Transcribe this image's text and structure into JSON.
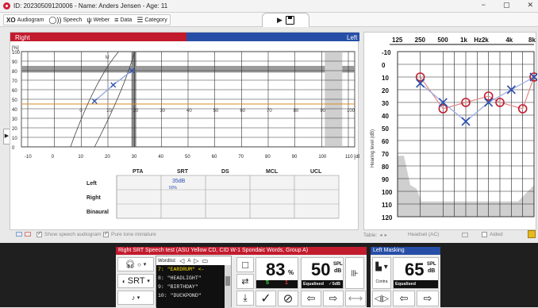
{
  "window": {
    "title": "ID: 20230509120006  -  Name: Anders Jensen - Age: 11",
    "controls": [
      "−",
      "▢",
      "✕"
    ]
  },
  "toolbar": {
    "tools": [
      {
        "icon": "XO",
        "label": "Audiogram"
      },
      {
        "icon": "speech-icon",
        "label": "Speech"
      },
      {
        "icon": "weber-icon",
        "label": "Weber"
      },
      {
        "icon": "data-icon",
        "label": "Data"
      },
      {
        "icon": "category-icon",
        "label": "Category"
      }
    ],
    "play_symbol": "▶"
  },
  "speech_audiogram": {
    "header_left": "Right",
    "header_right": "Left",
    "y_unit": "[%]",
    "y_ticks": [
      "100",
      "90",
      "80",
      "70",
      "60",
      "50",
      "40",
      "30",
      "20",
      "10",
      "0"
    ],
    "x_ticks": [
      "-10",
      "0",
      "10",
      "20",
      "30",
      "40",
      "50",
      "60",
      "70",
      "80",
      "90",
      "100",
      "110 [dB SPL]"
    ],
    "inner_ticks": [
      "0",
      "10",
      "20",
      "30",
      "40",
      "50",
      "60",
      "70",
      "80",
      "90",
      "100"
    ],
    "curve_labels": [
      "M",
      "S"
    ],
    "points": [
      {
        "x": 15,
        "y": 48
      },
      {
        "x": 22,
        "y": 65
      },
      {
        "x": 29,
        "y": 80
      }
    ],
    "colors": {
      "right": "#c21b2d",
      "left": "#274ea6",
      "marker": "#2c4fb0",
      "orange": "#d98b2b"
    }
  },
  "srt_table": {
    "headers": [
      "PTA",
      "SRT",
      "DS",
      "MCL",
      "UCL"
    ],
    "rows": [
      {
        "label": "Left",
        "srt_value": "35dB",
        "srt_sub": "50%"
      },
      {
        "label": "Right"
      },
      {
        "label": "Binaural"
      }
    ]
  },
  "pure_tone": {
    "freq_labels": [
      "125",
      "250",
      "500",
      "1k",
      "Hz2k",
      "4k",
      "8k"
    ],
    "y_ticks": [
      "-10",
      "0",
      "10",
      "20",
      "30",
      "40",
      "50",
      "60",
      "70",
      "80",
      "90",
      "100",
      "110",
      "120"
    ],
    "y_label": "Hearing level (dB)",
    "right_ear_O": [
      {
        "f": "250",
        "db": 10
      },
      {
        "f": "500",
        "db": 35
      },
      {
        "f": "1k",
        "db": 30
      },
      {
        "f": "2k",
        "db": 25
      },
      {
        "f": "3k",
        "db": 30
      },
      {
        "f": "6k",
        "db": 35
      },
      {
        "f": "8k",
        "db": 10
      }
    ],
    "left_ear_X": [
      {
        "f": "250",
        "db": 15
      },
      {
        "f": "500",
        "db": 30
      },
      {
        "f": "1k",
        "db": 45
      },
      {
        "f": "2k",
        "db": 30
      },
      {
        "f": "4k",
        "db": 20
      },
      {
        "f": "8k",
        "db": 10
      }
    ]
  },
  "options": {
    "show_speech_audiogram": "Show speech audiogram",
    "pure_tone_miniature": "Pure tone miniature",
    "table": "Table:",
    "headset": "Headset (AC)",
    "aided": "Aided"
  },
  "speech_test": {
    "header": "Right SRT Speech test (ASU Yellow CD, CID W-1 Spondaic Words, Group A)",
    "mode": "SRT",
    "wordlist_label": "Wordlist:",
    "wordlist_selected": "A",
    "words": [
      {
        "n": "7:",
        "w": "\"EARDRUM\" <-",
        "selected": true
      },
      {
        "n": "8:",
        "w": "\"HEADLIGHT\"",
        "selected": false
      },
      {
        "n": "9:",
        "w": "\"BIRTHDAY\"",
        "selected": false
      },
      {
        "n": "10:",
        "w": "\"DUCKPOND\"",
        "selected": false
      }
    ],
    "score": "83",
    "score_unit": "%",
    "correct": "5",
    "incorrect": "1",
    "level": "50",
    "level_unit_top": "SPL",
    "level_unit_bottom": "dB",
    "level_status": "Equalised",
    "level_step": "✓5dB"
  },
  "masking": {
    "header": "Left Masking",
    "level": "65",
    "level_unit_top": "SPL",
    "level_unit_bottom": "dB",
    "status": "Equalised",
    "contra_label": "Contra"
  }
}
